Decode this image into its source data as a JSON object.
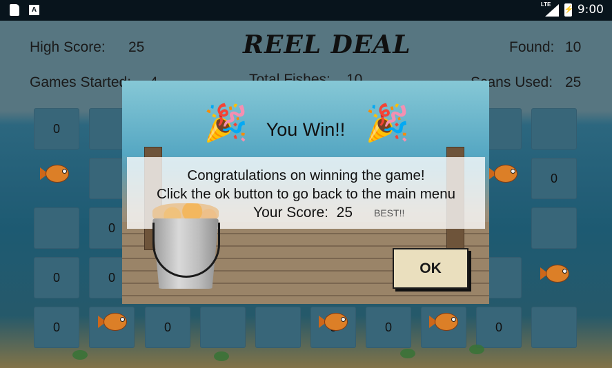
{
  "status_bar": {
    "network": "LTE",
    "time": "9:00",
    "icons": [
      "sd-card-icon",
      "a-icon",
      "signal-icon",
      "battery-charging-icon"
    ]
  },
  "header": {
    "high_score_label": "High Score:",
    "high_score_value": "25",
    "title": "REEL DEAL",
    "found_label": "Found:",
    "found_value": "10",
    "games_started_label": "Games Started:",
    "games_started_value": "4",
    "total_fishes_label": "Total Fishes:",
    "total_fishes_value": "10",
    "scans_used_label": "Scans Used:",
    "scans_used_value": "25"
  },
  "grid": {
    "tiles": [
      "0",
      "",
      "",
      "0",
      "0",
      "0",
      "0",
      "0",
      "0",
      "0",
      "0"
    ]
  },
  "dialog": {
    "title": "You Win!!",
    "line1": "Congratulations on winning the game!",
    "line2": "Click the ok button to go back to the main menu",
    "score_label": "Your Score:",
    "score_value": "25",
    "best_badge": "BEST!!",
    "ok_label": "OK",
    "party_emoji": "🎉"
  },
  "colors": {
    "status_bar": "#08141c",
    "tile": "#3c6c80",
    "ok_button": "#eadfbe"
  }
}
